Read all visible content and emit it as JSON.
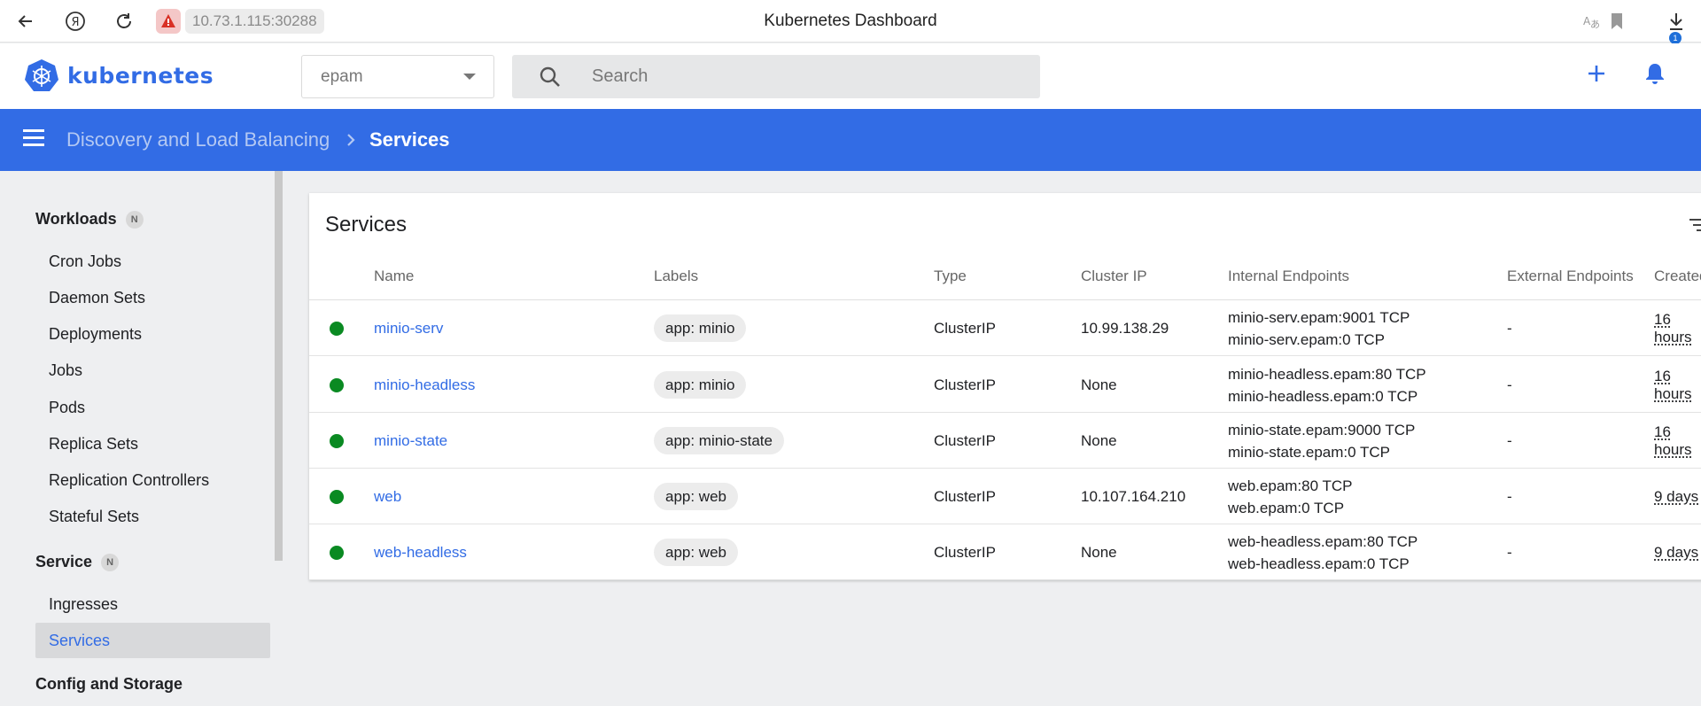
{
  "browser": {
    "url": "10.73.1.115:30288",
    "title": "Kubernetes Dashboard",
    "download_count": "1"
  },
  "app": {
    "logo_text": "kubernetes",
    "namespace": "epam",
    "search_placeholder": "Search"
  },
  "breadcrumb": {
    "parent": "Discovery and Load Balancing",
    "current": "Services"
  },
  "sidebar": {
    "sections": [
      {
        "label": "Workloads",
        "badge": "N"
      },
      {
        "label": "Service",
        "badge": "N"
      },
      {
        "label": "Config and Storage"
      }
    ],
    "workload_items": [
      "Cron Jobs",
      "Daemon Sets",
      "Deployments",
      "Jobs",
      "Pods",
      "Replica Sets",
      "Replication Controllers",
      "Stateful Sets"
    ],
    "service_items": [
      "Ingresses",
      "Services"
    ],
    "active_item": "Services"
  },
  "services_card": {
    "title": "Services",
    "columns": [
      "Name",
      "Labels",
      "Type",
      "Cluster IP",
      "Internal Endpoints",
      "External Endpoints",
      "Created"
    ],
    "rows": [
      {
        "name": "minio-serv",
        "label": "app: minio",
        "type": "ClusterIP",
        "cluster_ip": "10.99.138.29",
        "internal": [
          "minio-serv.epam:9001 TCP",
          "minio-serv.epam:0 TCP"
        ],
        "external": "-",
        "created": "16 hours"
      },
      {
        "name": "minio-headless",
        "label": "app: minio",
        "type": "ClusterIP",
        "cluster_ip": "None",
        "internal": [
          "minio-headless.epam:80 TCP",
          "minio-headless.epam:0 TCP"
        ],
        "external": "-",
        "created": "16 hours"
      },
      {
        "name": "minio-state",
        "label": "app: minio-state",
        "type": "ClusterIP",
        "cluster_ip": "None",
        "internal": [
          "minio-state.epam:9000 TCP",
          "minio-state.epam:0 TCP"
        ],
        "external": "-",
        "created": "16 hours"
      },
      {
        "name": "web",
        "label": "app: web",
        "type": "ClusterIP",
        "cluster_ip": "10.107.164.210",
        "internal": [
          "web.epam:80 TCP",
          "web.epam:0 TCP"
        ],
        "external": "-",
        "created": "9 days"
      },
      {
        "name": "web-headless",
        "label": "app: web",
        "type": "ClusterIP",
        "cluster_ip": "None",
        "internal": [
          "web-headless.epam:80 TCP",
          "web-headless.epam:0 TCP"
        ],
        "external": "-",
        "created": "9 days"
      }
    ]
  },
  "colors": {
    "brand": "#326ce5",
    "status_ok": "#0a8a22"
  }
}
